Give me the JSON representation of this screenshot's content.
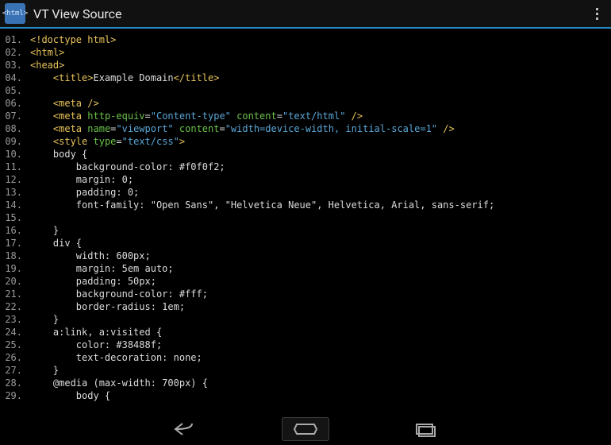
{
  "header": {
    "logo_text": "<html>",
    "title": "VT View Source"
  },
  "code": {
    "lines": [
      {
        "no": "01.",
        "segments": [
          {
            "cls": "tag",
            "t": "<!doctype html>"
          }
        ]
      },
      {
        "no": "02.",
        "segments": [
          {
            "cls": "tag",
            "t": "<html>"
          }
        ]
      },
      {
        "no": "03.",
        "segments": [
          {
            "cls": "tag",
            "t": "<head>"
          }
        ]
      },
      {
        "no": "04.",
        "segments": [
          {
            "cls": "plain",
            "t": "    "
          },
          {
            "cls": "tag",
            "t": "<title>"
          },
          {
            "cls": "plain",
            "t": "Example Domain"
          },
          {
            "cls": "tag",
            "t": "</title>"
          }
        ]
      },
      {
        "no": "05.",
        "segments": []
      },
      {
        "no": "06.",
        "segments": [
          {
            "cls": "plain",
            "t": "    "
          },
          {
            "cls": "tag",
            "t": "<meta />"
          }
        ]
      },
      {
        "no": "07.",
        "segments": [
          {
            "cls": "plain",
            "t": "    "
          },
          {
            "cls": "tag",
            "t": "<meta"
          },
          {
            "cls": "plain",
            "t": " "
          },
          {
            "cls": "attr",
            "t": "http-equiv"
          },
          {
            "cls": "plain",
            "t": "="
          },
          {
            "cls": "str",
            "t": "\"Content-type\""
          },
          {
            "cls": "plain",
            "t": " "
          },
          {
            "cls": "attr",
            "t": "content"
          },
          {
            "cls": "plain",
            "t": "="
          },
          {
            "cls": "str",
            "t": "\"text/html\""
          },
          {
            "cls": "plain",
            "t": " "
          },
          {
            "cls": "tag",
            "t": "/>"
          }
        ]
      },
      {
        "no": "08.",
        "segments": [
          {
            "cls": "plain",
            "t": "    "
          },
          {
            "cls": "tag",
            "t": "<meta"
          },
          {
            "cls": "plain",
            "t": " "
          },
          {
            "cls": "attr",
            "t": "name"
          },
          {
            "cls": "plain",
            "t": "="
          },
          {
            "cls": "str",
            "t": "\"viewport\""
          },
          {
            "cls": "plain",
            "t": " "
          },
          {
            "cls": "attr",
            "t": "content"
          },
          {
            "cls": "plain",
            "t": "="
          },
          {
            "cls": "str",
            "t": "\"width=device-width, initial-scale=1\""
          },
          {
            "cls": "plain",
            "t": " "
          },
          {
            "cls": "tag",
            "t": "/>"
          }
        ]
      },
      {
        "no": "09.",
        "segments": [
          {
            "cls": "plain",
            "t": "    "
          },
          {
            "cls": "tag",
            "t": "<style"
          },
          {
            "cls": "plain",
            "t": " "
          },
          {
            "cls": "attr",
            "t": "type"
          },
          {
            "cls": "plain",
            "t": "="
          },
          {
            "cls": "str",
            "t": "\"text/css\""
          },
          {
            "cls": "tag",
            "t": ">"
          }
        ]
      },
      {
        "no": "10.",
        "segments": [
          {
            "cls": "plain",
            "t": "    body {"
          }
        ]
      },
      {
        "no": "11.",
        "segments": [
          {
            "cls": "plain",
            "t": "        background-color: #f0f0f2;"
          }
        ]
      },
      {
        "no": "12.",
        "segments": [
          {
            "cls": "plain",
            "t": "        margin: 0;"
          }
        ]
      },
      {
        "no": "13.",
        "segments": [
          {
            "cls": "plain",
            "t": "        padding: 0;"
          }
        ]
      },
      {
        "no": "14.",
        "segments": [
          {
            "cls": "plain",
            "t": "        font-family: \"Open Sans\", \"Helvetica Neue\", Helvetica, Arial, sans-serif;"
          }
        ]
      },
      {
        "no": "15.",
        "segments": []
      },
      {
        "no": "16.",
        "segments": [
          {
            "cls": "plain",
            "t": "    }"
          }
        ]
      },
      {
        "no": "17.",
        "segments": [
          {
            "cls": "plain",
            "t": "    div {"
          }
        ]
      },
      {
        "no": "18.",
        "segments": [
          {
            "cls": "plain",
            "t": "        width: 600px;"
          }
        ]
      },
      {
        "no": "19.",
        "segments": [
          {
            "cls": "plain",
            "t": "        margin: 5em auto;"
          }
        ]
      },
      {
        "no": "20.",
        "segments": [
          {
            "cls": "plain",
            "t": "        padding: 50px;"
          }
        ]
      },
      {
        "no": "21.",
        "segments": [
          {
            "cls": "plain",
            "t": "        background-color: #fff;"
          }
        ]
      },
      {
        "no": "22.",
        "segments": [
          {
            "cls": "plain",
            "t": "        border-radius: 1em;"
          }
        ]
      },
      {
        "no": "23.",
        "segments": [
          {
            "cls": "plain",
            "t": "    }"
          }
        ]
      },
      {
        "no": "24.",
        "segments": [
          {
            "cls": "plain",
            "t": "    a:link, a:visited {"
          }
        ]
      },
      {
        "no": "25.",
        "segments": [
          {
            "cls": "plain",
            "t": "        color: #38488f;"
          }
        ]
      },
      {
        "no": "26.",
        "segments": [
          {
            "cls": "plain",
            "t": "        text-decoration: none;"
          }
        ]
      },
      {
        "no": "27.",
        "segments": [
          {
            "cls": "plain",
            "t": "    }"
          }
        ]
      },
      {
        "no": "28.",
        "segments": [
          {
            "cls": "plain",
            "t": "    @media (max-width: 700px) {"
          }
        ]
      },
      {
        "no": "29.",
        "segments": [
          {
            "cls": "plain",
            "t": "        body {"
          }
        ]
      }
    ]
  }
}
